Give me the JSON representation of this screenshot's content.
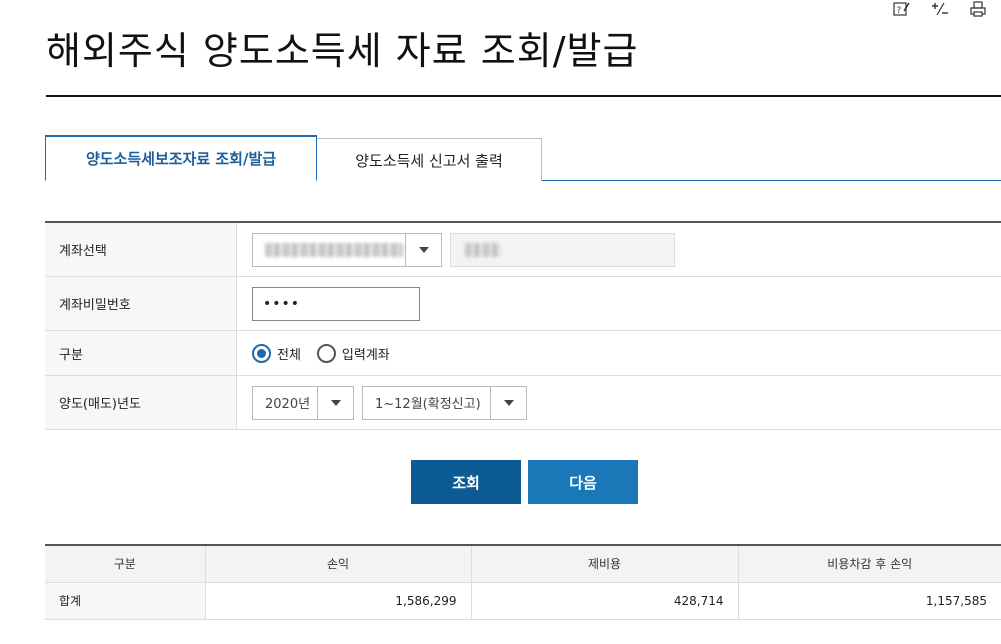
{
  "toolbar": {
    "icons": [
      "help-edit-icon",
      "calculator-icon",
      "print-icon"
    ]
  },
  "page": {
    "title": "해외주식 양도소득세 자료 조회/발급"
  },
  "tabs": [
    {
      "label": "양도소득세보조자료 조회/발급",
      "active": true
    },
    {
      "label": "양도소득세 신고서 출력",
      "active": false
    }
  ],
  "form": {
    "account_select": {
      "label": "계좌선택",
      "value_obscured": true
    },
    "account_password": {
      "label": "계좌비밀번호",
      "value": "••••"
    },
    "category": {
      "label": "구분",
      "options": [
        "전체",
        "입력계좌"
      ],
      "selected": "전체"
    },
    "transfer_year": {
      "label": "양도(매도)년도",
      "year_value": "2020년",
      "period_value": "1~12월(확정신고)"
    }
  },
  "actions": {
    "search_label": "조회",
    "next_label": "다음"
  },
  "results": {
    "headers": [
      "구분",
      "손익",
      "제비용",
      "비용차감 후 손익"
    ],
    "rows": [
      [
        "합계",
        "1,586,299",
        "428,714",
        "1,157,585"
      ]
    ]
  },
  "colors": {
    "accent": "#1e6ab0",
    "primary_button": "#0c5b92",
    "secondary_button": "#1a78b8"
  }
}
